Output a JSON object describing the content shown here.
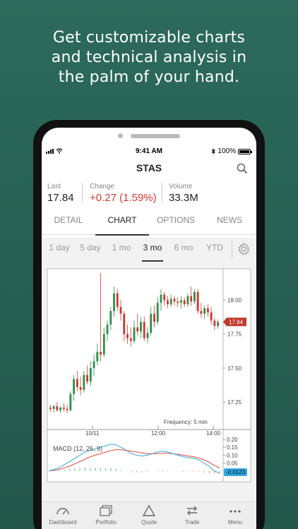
{
  "headline": "Get customizable charts\nand technical analysis in\nthe palm of your hand.",
  "status": {
    "time": "9:41 AM",
    "battery": "100%"
  },
  "ticker": "STAS",
  "quote": {
    "last_label": "Last",
    "last_value": "17.84",
    "change_label": "Change",
    "change_value": "+0.27 (1.59%)",
    "volume_label": "Volume",
    "volume_value": "33.3M"
  },
  "tabs": [
    "DETAIL",
    "CHART",
    "OPTIONS",
    "NEWS"
  ],
  "active_tab": "CHART",
  "ranges": [
    "1 day",
    "5 day",
    "1 mo",
    "3 mo",
    "6 mo",
    "YTD"
  ],
  "active_range": "3 mo",
  "colors": {
    "up": "#2f8f4e",
    "down": "#d0392f",
    "price_badge": "#c0392b",
    "macd_line": "#2ea8e0",
    "signal_line": "#e04a3a",
    "macd_badge": "#2ea8e0"
  },
  "chart_data": {
    "type": "candlestick",
    "price_ticks": [
      "18.00",
      "17.75",
      "17.50",
      "17.25"
    ],
    "time_ticks": [
      "10/11",
      "12:00",
      "14:00"
    ],
    "last_price_badge": "17.84",
    "frequency_label": "Frequency: 5 min",
    "macd_label": "MACD (12, 26, 9)",
    "macd_ticks": [
      "0.20",
      "0.15",
      "0.10",
      "0.05"
    ],
    "macd_badge": "-0.0123",
    "ylim": [
      17.1,
      18.2
    ],
    "candles": [
      {
        "o": 17.21,
        "h": 17.23,
        "l": 17.18,
        "c": 17.2
      },
      {
        "o": 17.2,
        "h": 17.23,
        "l": 17.17,
        "c": 17.22
      },
      {
        "o": 17.22,
        "h": 17.25,
        "l": 17.18,
        "c": 17.19
      },
      {
        "o": 17.19,
        "h": 17.22,
        "l": 17.17,
        "c": 17.21
      },
      {
        "o": 17.21,
        "h": 17.24,
        "l": 17.18,
        "c": 17.2
      },
      {
        "o": 17.2,
        "h": 17.23,
        "l": 17.17,
        "c": 17.19
      },
      {
        "o": 17.19,
        "h": 17.33,
        "l": 17.18,
        "c": 17.31
      },
      {
        "o": 17.31,
        "h": 17.45,
        "l": 17.26,
        "c": 17.42
      },
      {
        "o": 17.42,
        "h": 17.48,
        "l": 17.33,
        "c": 17.36
      },
      {
        "o": 17.36,
        "h": 17.44,
        "l": 17.3,
        "c": 17.34
      },
      {
        "o": 17.34,
        "h": 17.48,
        "l": 17.32,
        "c": 17.45
      },
      {
        "o": 17.45,
        "h": 17.52,
        "l": 17.38,
        "c": 17.4
      },
      {
        "o": 17.4,
        "h": 17.55,
        "l": 17.37,
        "c": 17.5
      },
      {
        "o": 17.5,
        "h": 17.6,
        "l": 17.44,
        "c": 17.55
      },
      {
        "o": 17.55,
        "h": 17.68,
        "l": 17.52,
        "c": 17.62
      },
      {
        "o": 17.62,
        "h": 18.2,
        "l": 17.55,
        "c": 17.6
      },
      {
        "o": 17.6,
        "h": 17.8,
        "l": 17.58,
        "c": 17.75
      },
      {
        "o": 17.75,
        "h": 17.85,
        "l": 17.7,
        "c": 17.82
      },
      {
        "o": 17.82,
        "h": 17.95,
        "l": 17.78,
        "c": 17.92
      },
      {
        "o": 17.92,
        "h": 18.1,
        "l": 17.88,
        "c": 18.05
      },
      {
        "o": 18.05,
        "h": 18.08,
        "l": 17.92,
        "c": 17.95
      },
      {
        "o": 17.95,
        "h": 18.0,
        "l": 17.85,
        "c": 17.9
      },
      {
        "o": 17.9,
        "h": 17.92,
        "l": 17.7,
        "c": 17.75
      },
      {
        "o": 17.75,
        "h": 17.82,
        "l": 17.68,
        "c": 17.72
      },
      {
        "o": 17.72,
        "h": 17.8,
        "l": 17.66,
        "c": 17.7
      },
      {
        "o": 17.7,
        "h": 17.85,
        "l": 17.68,
        "c": 17.8
      },
      {
        "o": 17.8,
        "h": 17.9,
        "l": 17.74,
        "c": 17.77
      },
      {
        "o": 17.77,
        "h": 17.88,
        "l": 17.72,
        "c": 17.84
      },
      {
        "o": 17.84,
        "h": 17.88,
        "l": 17.7,
        "c": 17.72
      },
      {
        "o": 17.72,
        "h": 17.8,
        "l": 17.68,
        "c": 17.76
      },
      {
        "o": 17.76,
        "h": 17.95,
        "l": 17.74,
        "c": 17.9
      },
      {
        "o": 17.9,
        "h": 17.96,
        "l": 17.8,
        "c": 17.84
      },
      {
        "o": 17.84,
        "h": 18.02,
        "l": 17.82,
        "c": 17.98
      },
      {
        "o": 17.98,
        "h": 18.08,
        "l": 17.92,
        "c": 18.04
      },
      {
        "o": 18.04,
        "h": 18.06,
        "l": 17.96,
        "c": 18.0
      },
      {
        "o": 18.0,
        "h": 18.03,
        "l": 17.94,
        "c": 17.97
      },
      {
        "o": 17.97,
        "h": 18.04,
        "l": 17.95,
        "c": 18.01
      },
      {
        "o": 18.01,
        "h": 18.03,
        "l": 17.96,
        "c": 17.99
      },
      {
        "o": 17.99,
        "h": 18.02,
        "l": 17.95,
        "c": 17.98
      },
      {
        "o": 17.98,
        "h": 18.03,
        "l": 17.94,
        "c": 18.0
      },
      {
        "o": 18.0,
        "h": 18.02,
        "l": 17.95,
        "c": 17.97
      },
      {
        "o": 17.97,
        "h": 18.05,
        "l": 17.95,
        "c": 18.03
      },
      {
        "o": 18.03,
        "h": 18.1,
        "l": 17.96,
        "c": 17.99
      },
      {
        "o": 17.99,
        "h": 18.08,
        "l": 17.97,
        "c": 18.06
      },
      {
        "o": 18.06,
        "h": 18.08,
        "l": 17.9,
        "c": 17.92
      },
      {
        "o": 17.92,
        "h": 17.98,
        "l": 17.87,
        "c": 17.9
      },
      {
        "o": 17.9,
        "h": 17.96,
        "l": 17.86,
        "c": 17.94
      },
      {
        "o": 17.94,
        "h": 17.97,
        "l": 17.88,
        "c": 17.91
      },
      {
        "o": 17.91,
        "h": 17.95,
        "l": 17.82,
        "c": 17.85
      },
      {
        "o": 17.85,
        "h": 17.87,
        "l": 17.78,
        "c": 17.81
      },
      {
        "o": 17.81,
        "h": 17.86,
        "l": 17.79,
        "c": 17.84
      }
    ],
    "macd": [
      0.0,
      0.01,
      0.02,
      0.04,
      0.06,
      0.08,
      0.1,
      0.12,
      0.13,
      0.14,
      0.15,
      0.16,
      0.17,
      0.165,
      0.15,
      0.13,
      0.11,
      0.1,
      0.095,
      0.1,
      0.11,
      0.12,
      0.125,
      0.12,
      0.11,
      0.1,
      0.09,
      0.085,
      0.08,
      0.07,
      0.05,
      0.03,
      0.0,
      -0.0123
    ],
    "signal": [
      0.0,
      0.005,
      0.01,
      0.02,
      0.03,
      0.045,
      0.06,
      0.075,
      0.09,
      0.1,
      0.11,
      0.12,
      0.13,
      0.135,
      0.135,
      0.13,
      0.125,
      0.12,
      0.115,
      0.11,
      0.11,
      0.11,
      0.112,
      0.112,
      0.11,
      0.105,
      0.1,
      0.095,
      0.09,
      0.082,
      0.07,
      0.055,
      0.035,
      0.02
    ]
  },
  "bottom_nav": [
    "Dashboard",
    "Portfolio",
    "Quote",
    "Trade",
    "Menu"
  ]
}
